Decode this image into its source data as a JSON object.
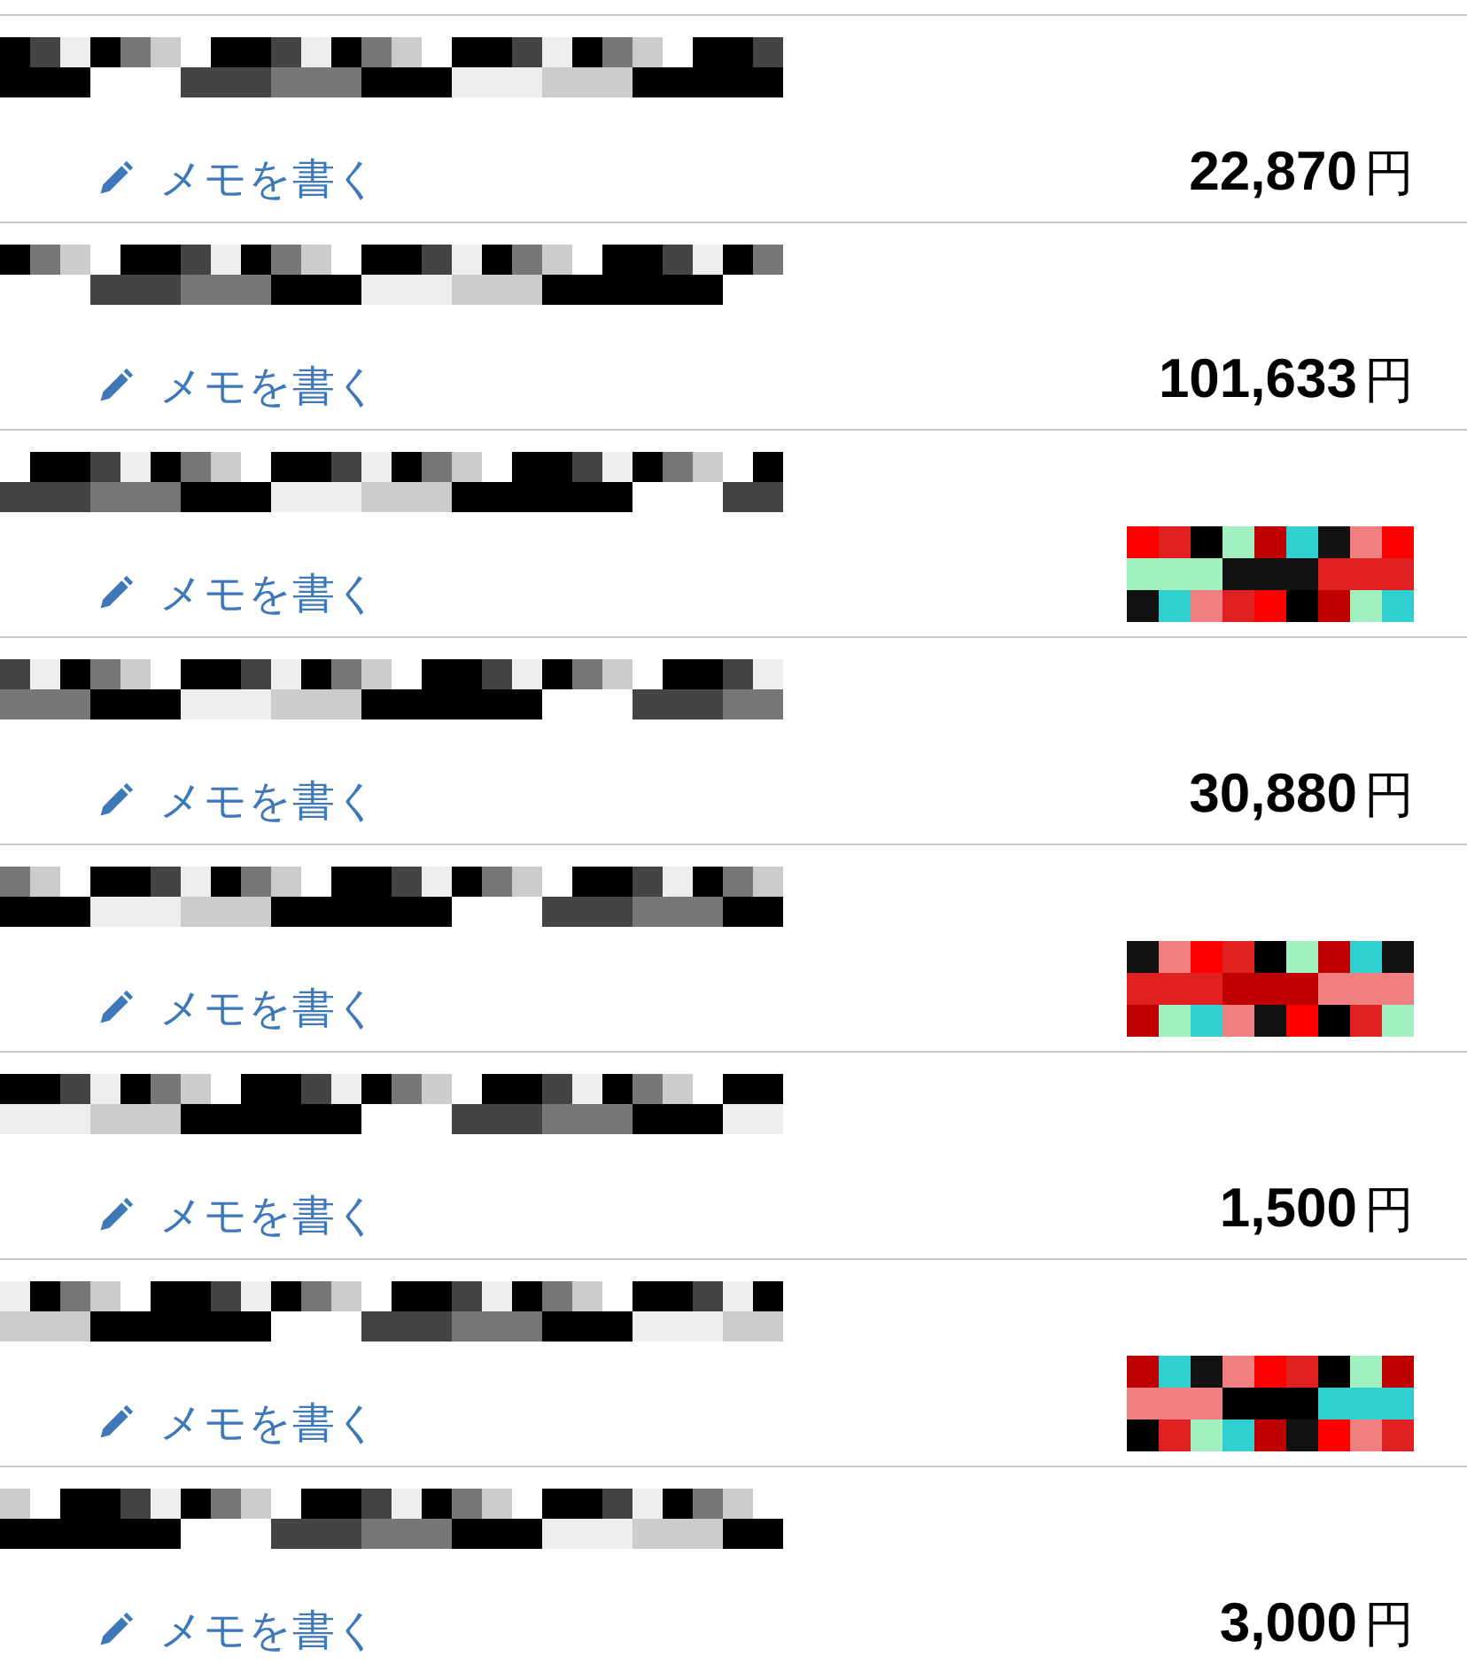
{
  "transactions": [
    {
      "title_redacted": true,
      "memo_link": "メモを書く",
      "amount": "22,870",
      "currency": "円",
      "amount_redacted": false
    },
    {
      "title_redacted": true,
      "memo_link": "メモを書く",
      "amount": "101,633",
      "currency": "円",
      "amount_redacted": false
    },
    {
      "title_redacted": true,
      "memo_link": "メモを書く",
      "amount_redacted": true
    },
    {
      "title_redacted": true,
      "memo_link": "メモを書く",
      "amount": "30,880",
      "currency": "円",
      "amount_redacted": false
    },
    {
      "title_redacted": true,
      "memo_link": "メモを書く",
      "amount_redacted": true
    },
    {
      "title_redacted": true,
      "memo_link": "メモを書く",
      "amount": "1,500",
      "currency": "円",
      "amount_redacted": false
    },
    {
      "title_redacted": true,
      "memo_link": "メモを書く",
      "amount_redacted": true
    },
    {
      "title_redacted": true,
      "memo_link": "メモを書く",
      "amount": "3,000",
      "currency": "円",
      "amount_redacted": false
    }
  ]
}
